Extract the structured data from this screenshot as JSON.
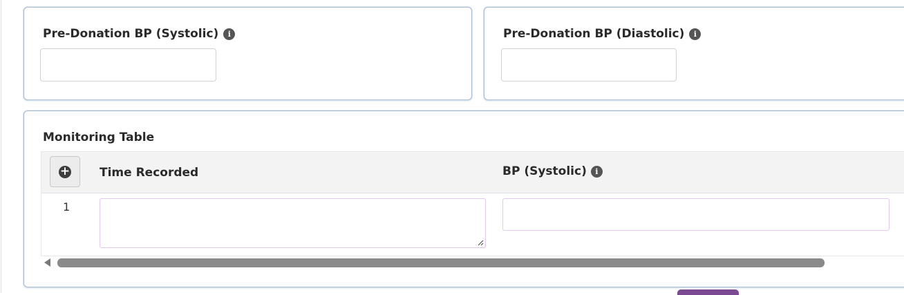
{
  "systolic_field": {
    "label": "Pre-Donation BP (Systolic)",
    "info_icon": "info-circle-icon",
    "value": ""
  },
  "diastolic_field": {
    "label": "Pre-Donation BP (Diastolic)",
    "info_icon": "info-circle-icon",
    "value": ""
  },
  "monitoring_table": {
    "title": "Monitoring Table",
    "add_row_icon": "plus-circle-icon",
    "columns": [
      {
        "label": "Time Recorded",
        "has_info": false
      },
      {
        "label": "BP (Systolic)",
        "has_info": true
      }
    ],
    "rows": [
      {
        "number": "1",
        "time_recorded": "",
        "bp_systolic": ""
      }
    ]
  },
  "info_glyph": "i",
  "add_glyph": "+"
}
